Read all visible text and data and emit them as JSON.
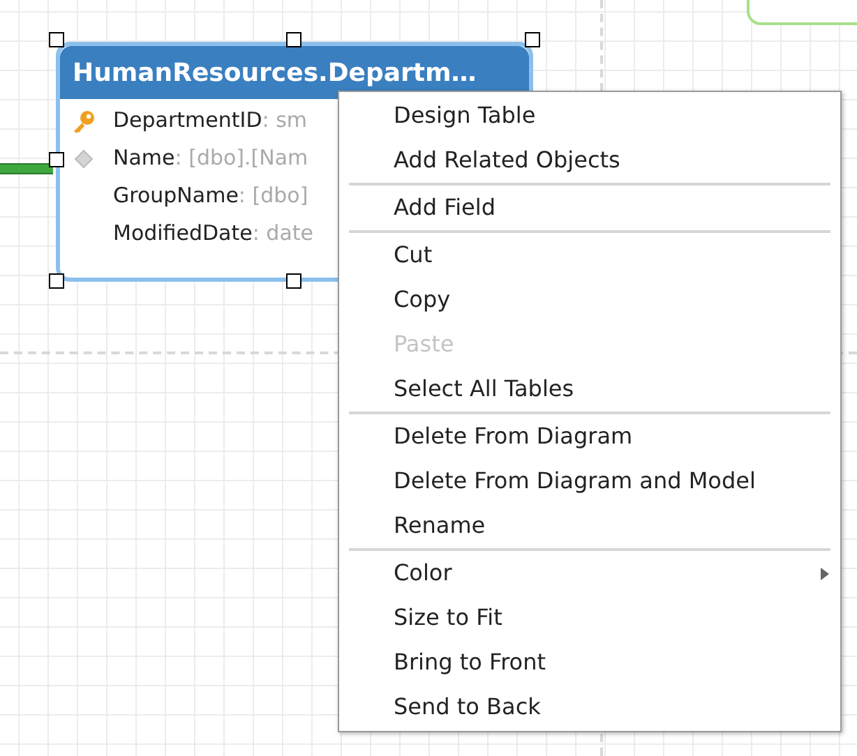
{
  "table": {
    "title": "HumanResources.Departm…",
    "selected": true,
    "fields": [
      {
        "name": "DepartmentID",
        "type": ": sm",
        "kind": "primary"
      },
      {
        "name": "Name",
        "type": ": [dbo].[Nam",
        "kind": "indexed"
      },
      {
        "name": "GroupName",
        "type": ": [dbo]",
        "kind": "plain"
      },
      {
        "name": "ModifiedDate",
        "type": ": date",
        "kind": "plain"
      }
    ]
  },
  "context_menu": {
    "groups": [
      [
        {
          "label": "Design Table",
          "disabled": false,
          "submenu": false
        },
        {
          "label": "Add Related Objects",
          "disabled": false,
          "submenu": false
        }
      ],
      [
        {
          "label": "Add Field",
          "disabled": false,
          "submenu": false
        }
      ],
      [
        {
          "label": "Cut",
          "disabled": false,
          "submenu": false
        },
        {
          "label": "Copy",
          "disabled": false,
          "submenu": false
        },
        {
          "label": "Paste",
          "disabled": true,
          "submenu": false
        },
        {
          "label": "Select All Tables",
          "disabled": false,
          "submenu": false
        }
      ],
      [
        {
          "label": "Delete From Diagram",
          "disabled": false,
          "submenu": false
        },
        {
          "label": "Delete From Diagram and Model",
          "disabled": false,
          "submenu": false
        },
        {
          "label": "Rename",
          "disabled": false,
          "submenu": false
        }
      ],
      [
        {
          "label": "Color",
          "disabled": false,
          "submenu": true
        },
        {
          "label": "Size to Fit",
          "disabled": false,
          "submenu": false
        },
        {
          "label": "Bring to Front",
          "disabled": false,
          "submenu": false
        },
        {
          "label": "Send to Back",
          "disabled": false,
          "submenu": false
        }
      ]
    ]
  }
}
